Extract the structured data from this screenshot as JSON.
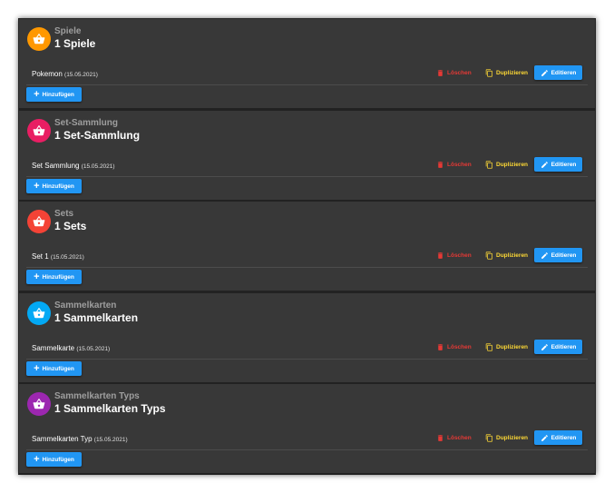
{
  "sections": [
    {
      "category": "Spiele",
      "title": "1 Spiele",
      "item_name": "Pokemon",
      "item_date": "(15.05.2021)",
      "color": "#ff9800"
    },
    {
      "category": "Set-Sammlung",
      "title": "1 Set-Sammlung",
      "item_name": "Set Sammlung",
      "item_date": "(15.05.2021)",
      "color": "#e91e63"
    },
    {
      "category": "Sets",
      "title": "1 Sets",
      "item_name": "Set 1",
      "item_date": "(15.05.2021)",
      "color": "#f44336"
    },
    {
      "category": "Sammelkarten",
      "title": "1 Sammelkarten",
      "item_name": "Sammelkarte",
      "item_date": "(15.05.2021)",
      "color": "#03a9f4"
    },
    {
      "category": "Sammelkarten Typs",
      "title": "1 Sammelkarten Typs",
      "item_name": "Sammelkarten Typ",
      "item_date": "(15.05.2021)",
      "color": "#9c27b0"
    }
  ],
  "labels": {
    "delete": "Löschen",
    "duplicate": "Duplizieren",
    "edit": "Editieren",
    "add": "Hinzufügen"
  },
  "icons": {
    "avatar": "basket-icon",
    "delete": "trash-icon",
    "duplicate": "copy-icon",
    "edit": "pencil-icon",
    "add": "plus-icon"
  },
  "colors": {
    "accent": "#2196f3",
    "delete": "#e53935",
    "duplicate": "#fdd835",
    "card_bg": "#383838"
  }
}
